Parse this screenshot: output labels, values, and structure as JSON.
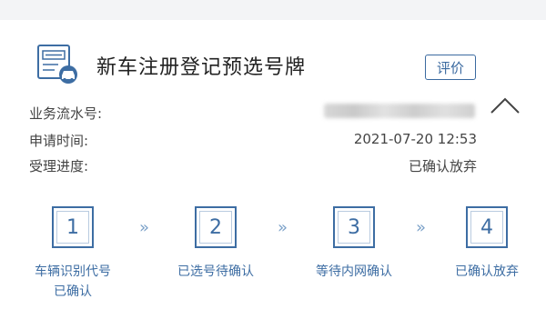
{
  "header": {
    "title": "新车注册登记预选号牌",
    "icon": "registration-document-car-icon",
    "rate_label": "评价"
  },
  "details": {
    "serial_label": "业务流水号:",
    "serial_value": "",
    "time_label": "申请时间:",
    "time_value": "2021-07-20 12:53",
    "progress_label": "受理进度:",
    "progress_value": "已确认放弃"
  },
  "collapse_icon": "chevron-up-icon",
  "colors": {
    "accent": "#3d6da3",
    "background": "#f3f4f6",
    "card": "#ffffff"
  },
  "steps": [
    {
      "number": "1",
      "label_line1": "车辆识别代号",
      "label_line2": "已确认"
    },
    {
      "number": "2",
      "label_line1": "已选号待确认",
      "label_line2": ""
    },
    {
      "number": "3",
      "label_line1": "等待内网确认",
      "label_line2": ""
    },
    {
      "number": "4",
      "label_line1": "已确认放弃",
      "label_line2": ""
    }
  ],
  "step_separator": "»"
}
